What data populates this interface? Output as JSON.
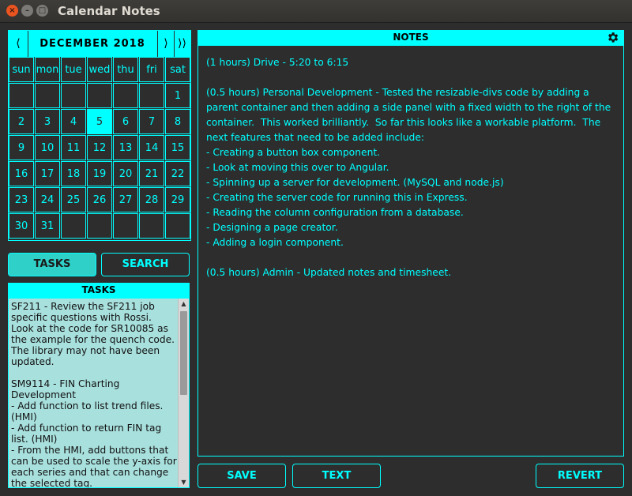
{
  "window": {
    "title": "Calendar Notes",
    "close_glyph": "×",
    "min_glyph": "–",
    "max_glyph": "□"
  },
  "calendar": {
    "prev_label": "⟨",
    "month_label": "DECEMBER 2018",
    "next_label": "⟩",
    "next_year_label": "⟩⟩",
    "weekdays": [
      "sun",
      "mon",
      "tue",
      "wed",
      "thu",
      "fri",
      "sat"
    ],
    "weeks": [
      [
        "",
        "",
        "",
        "",
        "",
        "",
        "1"
      ],
      [
        "2",
        "3",
        "4",
        "5",
        "6",
        "7",
        "8"
      ],
      [
        "9",
        "10",
        "11",
        "12",
        "13",
        "14",
        "15"
      ],
      [
        "16",
        "17",
        "18",
        "19",
        "20",
        "21",
        "22"
      ],
      [
        "23",
        "24",
        "25",
        "26",
        "27",
        "28",
        "29"
      ],
      [
        "30",
        "31",
        "",
        "",
        "",
        "",
        ""
      ]
    ],
    "selected_day": "5"
  },
  "tabs": {
    "tasks_label": "TASKS",
    "search_label": "SEARCH"
  },
  "tasks": {
    "header": "TASKS",
    "text": "SF211 - Review the SF211 job specific questions with Rossi.  Look at the code for SR10085 as the example for the quench code.  The library may not have been updated.\n\nSM9114 - FIN Charting Development\n- Add function to list trend files. (HMI)\n- Add function to return FIN tag list. (HMI)\n- From the HMI, add buttons that can be used to scale the y-axis for each series and that can change the selected tag.\n- From the HMI, develop a tag picker that looks like FINs"
  },
  "notes": {
    "header": "NOTES",
    "text": "(1 hours) Drive - 5:20 to 6:15\n\n(0.5 hours) Personal Development - Tested the resizable-divs code by adding a parent container and then adding a side panel with a fixed width to the right of the container.  This worked brilliantly.  So far this looks like a workable platform.  The next features that need to be added include:\n- Creating a button box component.\n- Look at moving this over to Angular.\n- Spinning up a server for development. (MySQL and node.js)\n- Creating the server code for running this in Express.\n- Reading the column configuration from a database.\n- Designing a page creator.\n- Adding a login component.\n\n(0.5 hours) Admin - Updated notes and timesheet."
  },
  "buttons": {
    "save_label": "SAVE",
    "text_label": "TEXT",
    "revert_label": "REVERT"
  },
  "colors": {
    "accent": "#00ffff",
    "background": "#2d2d2d",
    "task_panel": "#a8e0dd",
    "active_tab": "#2fd0c8"
  },
  "icons": {
    "settings": "gear-icon"
  }
}
